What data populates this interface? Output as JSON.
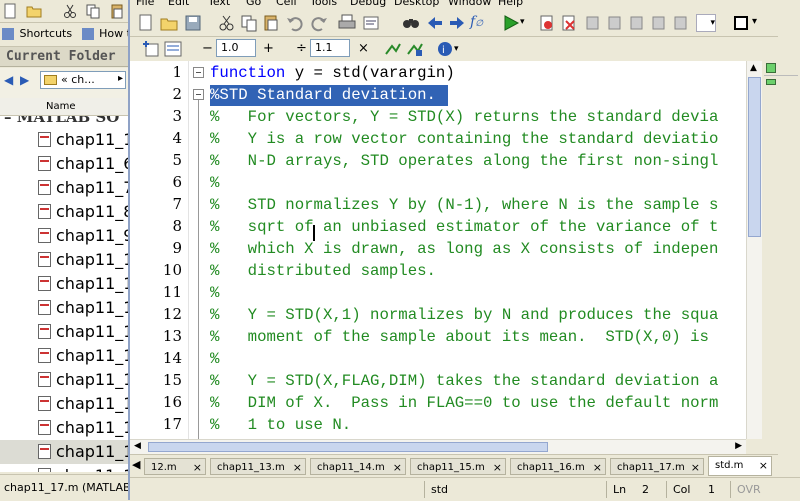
{
  "left_panel": {
    "shortcuts_label": "Shortcuts",
    "howto_label": "How to",
    "current_folder_title": "Current Folder",
    "path_text": "« ch...",
    "name_column": "Name",
    "tree_root": "MATLAB SO",
    "files": [
      "chap11_1",
      "chap11_6",
      "chap11_7",
      "chap11_8",
      "chap11_9",
      "chap11_1",
      "chap11_1",
      "chap11_1",
      "chap11_1",
      "chap11_1",
      "chap11_1",
      "chap11_1",
      "chap11_1",
      "chap11_1",
      "chap11_1",
      "chap11_1"
    ],
    "selected_index": 13,
    "status_text": "chap11_17.m (MATLAB"
  },
  "editor": {
    "menu": [
      "File",
      "Edit",
      "Text",
      "Go",
      "Cell",
      "Tools",
      "Debug",
      "Desktop",
      "Window",
      "Help"
    ],
    "toolbar2": {
      "minus": "−",
      "field1": "1.0",
      "plus": "+",
      "divide": "÷",
      "field2": "1.1",
      "times": "×"
    },
    "lines": [
      {
        "n": "1",
        "text": "function y = std(varargin)",
        "kind": "code"
      },
      {
        "n": "2",
        "text": "%STD Standard deviation.",
        "kind": "selected"
      },
      {
        "n": "3",
        "text": "%   For vectors, Y = STD(X) returns the standard devia",
        "kind": "comment"
      },
      {
        "n": "4",
        "text": "%   Y is a row vector containing the standard deviatio",
        "kind": "comment"
      },
      {
        "n": "5",
        "text": "%   N-D arrays, STD operates along the first non-singl",
        "kind": "comment"
      },
      {
        "n": "6",
        "text": "%",
        "kind": "comment"
      },
      {
        "n": "7",
        "text": "%   STD normalizes Y by (N-1), where N is the sample s",
        "kind": "comment"
      },
      {
        "n": "8",
        "text": "%   sqrt of an unbiased estimator of the variance of t",
        "kind": "comment"
      },
      {
        "n": "9",
        "text": "%   which X is drawn, as long as X consists of indepen",
        "kind": "comment"
      },
      {
        "n": "10",
        "text": "%   distributed samples.",
        "kind": "comment"
      },
      {
        "n": "11",
        "text": "%",
        "kind": "comment"
      },
      {
        "n": "12",
        "text": "%   Y = STD(X,1) normalizes by N and produces the squa",
        "kind": "comment"
      },
      {
        "n": "13",
        "text": "%   moment of the sample about its mean.  STD(X,0) is",
        "kind": "comment"
      },
      {
        "n": "14",
        "text": "%",
        "kind": "comment"
      },
      {
        "n": "15",
        "text": "%   Y = STD(X,FLAG,DIM) takes the standard deviation a",
        "kind": "comment"
      },
      {
        "n": "16",
        "text": "%   DIM of X.  Pass in FLAG==0 to use the default norm",
        "kind": "comment"
      },
      {
        "n": "17",
        "text": "%   1 to use N.",
        "kind": "comment"
      }
    ],
    "tabs": [
      {
        "label": "12.m",
        "active": false
      },
      {
        "label": "chap11_13.m",
        "active": false
      },
      {
        "label": "chap11_14.m",
        "active": false
      },
      {
        "label": "chap11_15.m",
        "active": false
      },
      {
        "label": "chap11_16.m",
        "active": false
      },
      {
        "label": "chap11_17.m",
        "active": false
      },
      {
        "label": "std.m",
        "active": true
      }
    ],
    "tab_close": "×",
    "status": {
      "function_name": "std",
      "ln_label": "Ln",
      "ln_value": "2",
      "col_label": "Col",
      "col_value": "1",
      "ovr": "OVR"
    }
  },
  "colors": {
    "comment": "#228b22",
    "keyword": "#0000ff",
    "selection": "#3163b5"
  }
}
